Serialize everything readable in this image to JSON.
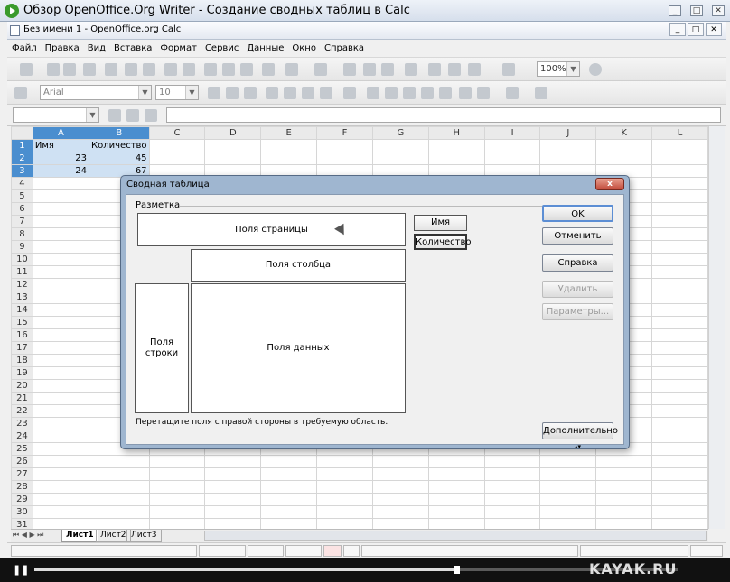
{
  "player": {
    "title": "Обзор OpenOffice.Org Writer - Создание сводных таблиц в Calc",
    "minimize": "_",
    "restore": "□",
    "close": "✕",
    "watermark": "KAYAK.RU"
  },
  "app": {
    "title": "Без имени 1 - OpenOffice.org Calc",
    "minimize": "_",
    "restore": "□",
    "close": "✕"
  },
  "menu": [
    "Файл",
    "Правка",
    "Вид",
    "Вставка",
    "Формат",
    "Сервис",
    "Данные",
    "Окно",
    "Справка"
  ],
  "toolbar": {
    "zoom": "100%",
    "font": "Arial",
    "size": "10"
  },
  "grid": {
    "columns": [
      "A",
      "B",
      "C",
      "D",
      "E",
      "F",
      "G",
      "H",
      "I",
      "J",
      "K",
      "L"
    ],
    "rows": [
      "1",
      "2",
      "3",
      "4",
      "5",
      "6",
      "7",
      "8",
      "9",
      "10",
      "11",
      "12",
      "13",
      "14",
      "15",
      "16",
      "17",
      "18",
      "19",
      "20",
      "21",
      "22",
      "23",
      "24",
      "25",
      "26",
      "27",
      "28",
      "29",
      "30",
      "31"
    ],
    "cells": {
      "A1": "Имя",
      "B1": "Количество",
      "A2": "23",
      "B2": "45",
      "A3": "24",
      "B3": "67"
    }
  },
  "sheets": [
    "Лист1",
    "Лист2",
    "Лист3"
  ],
  "dialog": {
    "title": "Сводная таблица",
    "close": "x",
    "layout_label": "Разметка",
    "page_fields": "Поля страницы",
    "column_fields": "Поля столбца",
    "row_fields_1": "Поля",
    "row_fields_2": "строки",
    "data_fields": "Поля данных",
    "field_name": "Имя",
    "field_qty": "Количество",
    "hint": "Перетащите поля с правой стороны в требуемую область.",
    "ok": "OK",
    "cancel": "Отменить",
    "help": "Справка",
    "delete": "Удалить",
    "options": "Параметры...",
    "more": "Дополнительно"
  }
}
